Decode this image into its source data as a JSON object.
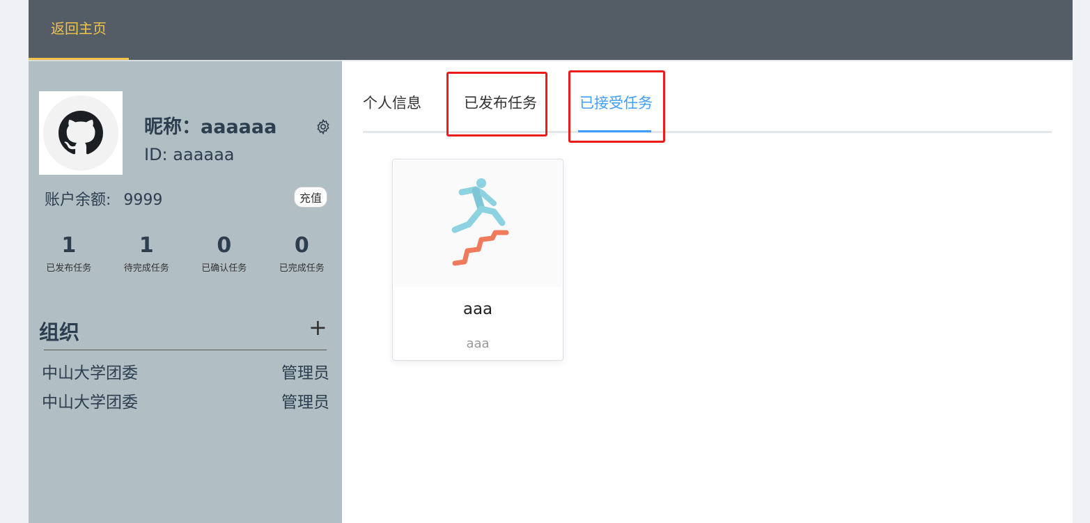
{
  "nav": {
    "home": "返回主页"
  },
  "profile": {
    "nickname": "昵称：aaaaaa",
    "id": "ID: aaaaaa",
    "balance_label": "账户余额:",
    "balance_value": "9999",
    "recharge": "充值"
  },
  "stats": [
    {
      "value": "1",
      "label": "已发布任务"
    },
    {
      "value": "1",
      "label": "待完成任务"
    },
    {
      "value": "0",
      "label": "已确认任务"
    },
    {
      "value": "0",
      "label": "已完成任务"
    }
  ],
  "org": {
    "title": "组织",
    "add": "+",
    "items": [
      {
        "name": "中山大学团委",
        "role": "管理员"
      },
      {
        "name": "中山大学团委",
        "role": "管理员"
      }
    ]
  },
  "tabs": [
    {
      "label": "个人信息"
    },
    {
      "label": "已发布任务"
    },
    {
      "label": "已接受任务"
    }
  ],
  "active_tab": "已接受任务",
  "task_card": {
    "title": "aaa",
    "subtitle": "aaa"
  },
  "colors": {
    "topbar": "#545d66",
    "accent": "#f2c34b",
    "sidebar": "#b1bec3",
    "active_tab": "#409eff",
    "highlight": "#ee1b1b"
  }
}
